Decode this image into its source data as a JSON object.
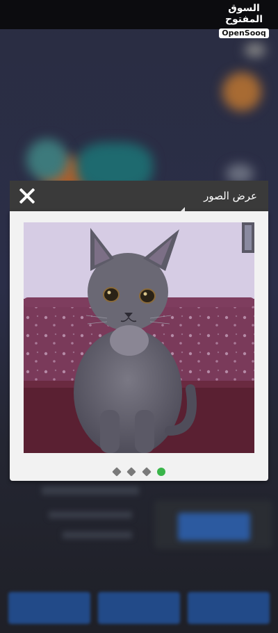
{
  "brand": {
    "arabic": "السوق المفتوح",
    "latin": "OpenSooq"
  },
  "gallery": {
    "title": "عرض الصور",
    "photo_alt": "cat",
    "dots": [
      {
        "active": false
      },
      {
        "active": false
      },
      {
        "active": false
      },
      {
        "active": true
      }
    ]
  },
  "colors": {
    "header_bg": "#3a3a3a",
    "modal_bg": "#f2f2f2",
    "active_dot": "#3ab54a",
    "inactive_dot": "#7a7a7a"
  }
}
